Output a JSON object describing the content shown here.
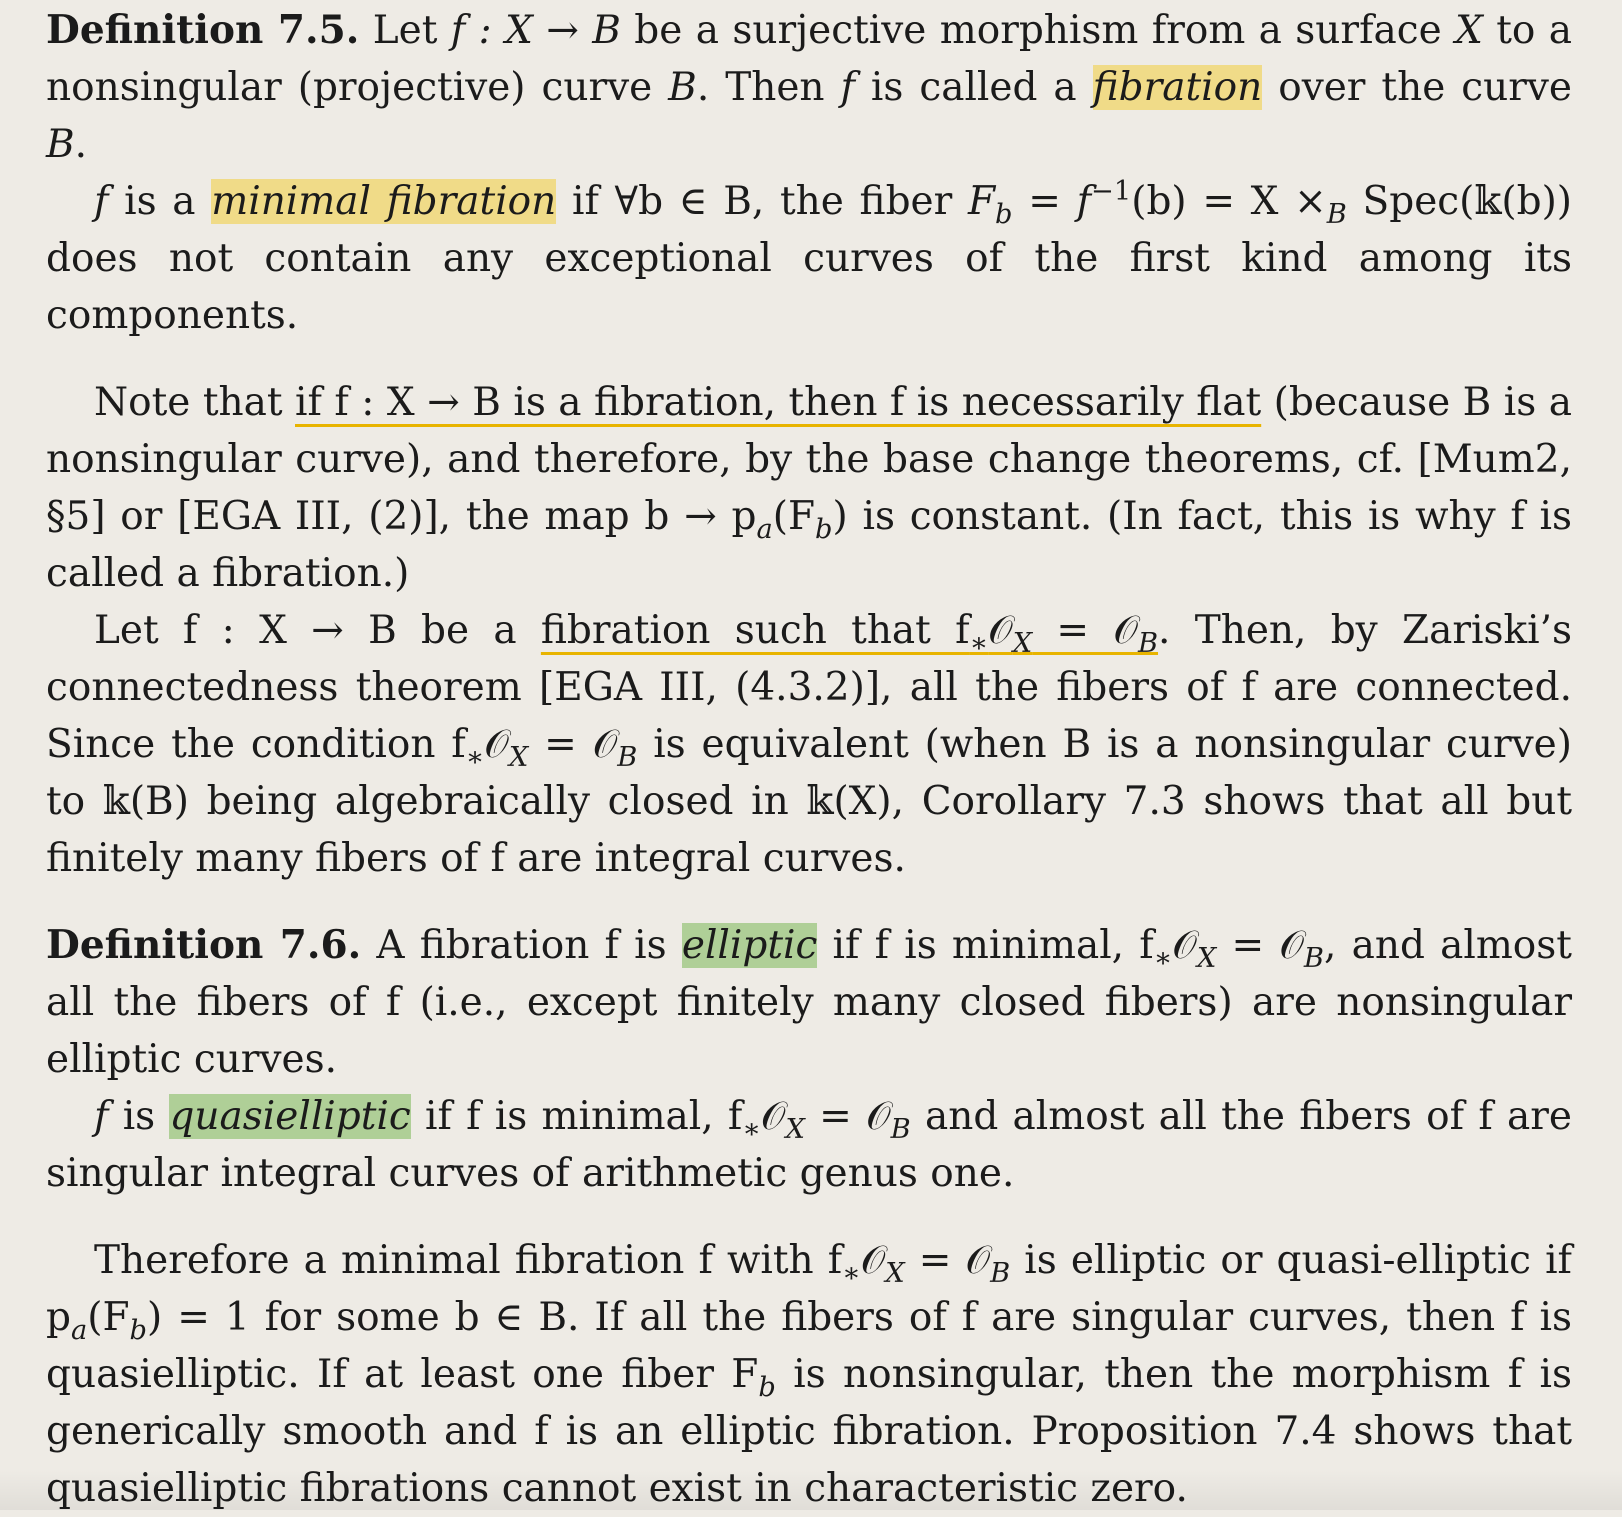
{
  "def75": {
    "head": "Definition 7.5.",
    "t1": "Let",
    "m1": "f : X → B",
    "t2": "be a surjective morphism from a surface",
    "m2": "X",
    "t3": "to a nonsingular (projective) curve",
    "m3": "B",
    "t4": ". Then",
    "m4": "f",
    "t5": "is called a",
    "term": "fibration",
    "t6": "over the curve",
    "m5": "B",
    "t7": "."
  },
  "def75b": {
    "m1": "f",
    "t1": "is a",
    "term": "minimal fibration",
    "t2": "if ∀b ∈ B, the fiber",
    "m2": "F",
    "m2sub": "b",
    "t3": "=",
    "m3": "f",
    "m3sup": "−1",
    "t4": "(b) = X ×",
    "t4sub": "B",
    "t5": "Spec(𝕜(b)) does not contain any exceptional curves of the first kind among its components."
  },
  "note1": {
    "t1": "Note that",
    "u1": "if f : X → B is a fibration, then f is necessarily flat",
    "t2": "(because B is a nonsingular curve), and therefore, by the base change theorems, cf. [Mum2, §5] or [EGA III, (2)], the map b → p",
    "t2sub": "a",
    "t3": "(F",
    "t3sub": "b",
    "t4": ") is constant. (In fact, this is why f is called a fibration.)"
  },
  "note2": {
    "t1": "Let f : X → B be a",
    "u1": "fibration such that f",
    "u1sub1": "∗",
    "u1b": "𝒪",
    "u1sub2": "X",
    "u1c": " = 𝒪",
    "u1sub3": "B",
    "t2": ". Then, by Zariski’s connectedness theorem [EGA III, (4.3.2)], all the fibers of f are connected. Since the condition f",
    "t2sub1": "∗",
    "t2b": "𝒪",
    "t2sub2": "X",
    "t2c": " = 𝒪",
    "t2sub3": "B",
    "t3": " is equivalent (when B is a nonsingular curve) to 𝕜(B) being algebraically closed in 𝕜(X), Corollary 7.3 shows that all but finitely many fibers of f are integral curves."
  },
  "def76": {
    "head": "Definition 7.6.",
    "t1": "A fibration f is",
    "term": "elliptic",
    "t2": "if f is minimal, f",
    "t2sub1": "∗",
    "t2b": "𝒪",
    "t2sub2": "X",
    "t2c": " = 𝒪",
    "t2sub3": "B",
    "t3": ", and almost all the fibers of f (i.e., except finitely many closed fibers) are nonsingular elliptic curves."
  },
  "def76b": {
    "m1": "f",
    "t1": "is",
    "term": "quasielliptic",
    "t2": "if f is minimal, f",
    "t2sub1": "∗",
    "t2b": "𝒪",
    "t2sub2": "X",
    "t2c": " = 𝒪",
    "t2sub3": "B",
    "t3": " and almost all the fibers of f are singular integral curves of arithmetic genus one."
  },
  "note3": {
    "t1": "Therefore a minimal fibration f with f",
    "t1sub1": "∗",
    "t1b": "𝒪",
    "t1sub2": "X",
    "t1c": " = 𝒪",
    "t1sub3": "B",
    "t2": " is elliptic or quasi-elliptic if p",
    "t2sub": "a",
    "t3": "(F",
    "t3sub": "b",
    "t4": ") = 1 for some b ∈ B. If all the fibers of f are singular curves, then f is quasielliptic. If at least one fiber F",
    "t4sub": "b",
    "t5": " is nonsingular, then the morphism f is generically smooth and f is an elliptic fibration. Proposition 7.4 shows that quasielliptic fibrations cannot exist in characteristic zero."
  },
  "colors": {
    "background": "#eeebe5",
    "highlight_yellow": "#f0db88",
    "highlight_green": "#afcf97",
    "underline_yellow": "#e8b400"
  }
}
